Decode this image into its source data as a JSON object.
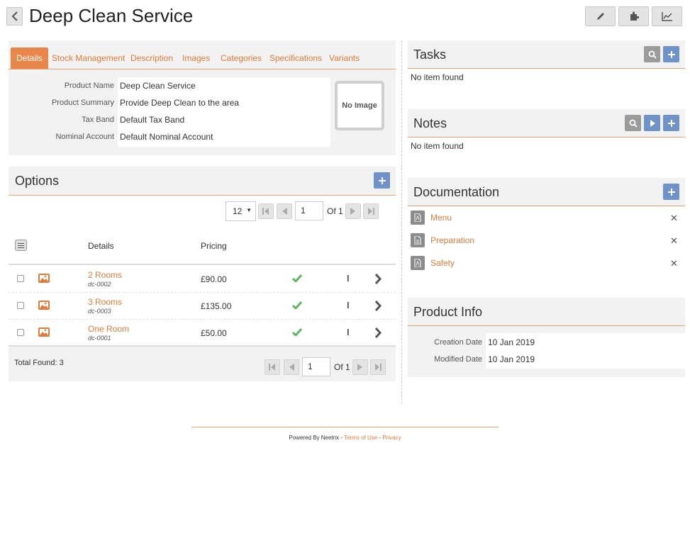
{
  "header": {
    "title": "Deep Clean Service"
  },
  "details": {
    "tabs": [
      "Details",
      "Stock Management",
      "Description",
      "Images",
      "Categories",
      "Specifications",
      "Variants"
    ],
    "fields": [
      {
        "label": "Product Name",
        "value": "Deep Clean Service"
      },
      {
        "label": "Product Summary",
        "value": "Provide Deep Clean to the area"
      },
      {
        "label": "Tax Band",
        "value": "Default Tax Band"
      },
      {
        "label": "Nominal Account",
        "value": "Default Nominal Account"
      }
    ],
    "no_image": "No Image"
  },
  "options": {
    "title": "Options",
    "page_size": "12",
    "page": "1",
    "of": "Of 1",
    "columns": {
      "details": "Details",
      "pricing": "Pricing"
    },
    "rows": [
      {
        "name": "2 Rooms",
        "code": "dc-0002",
        "price": "£90.00"
      },
      {
        "name": "3 Rooms",
        "code": "dc-0003",
        "price": "£135.00"
      },
      {
        "name": "One Room",
        "code": "dc-0001",
        "price": "£50.00"
      }
    ],
    "total": "Total Found: 3"
  },
  "tasks": {
    "title": "Tasks",
    "empty": "No item found"
  },
  "notes": {
    "title": "Notes",
    "empty": "No item found"
  },
  "documentation": {
    "title": "Documentation",
    "items": [
      {
        "name": "Menu",
        "icon": "pdf-icon"
      },
      {
        "name": "Preparation",
        "icon": "document-icon"
      },
      {
        "name": "Safety",
        "icon": "pdf-icon"
      }
    ]
  },
  "product_info": {
    "title": "Product Info",
    "fields": [
      {
        "label": "Creation Date",
        "value": "10 Jan 2019"
      },
      {
        "label": "Modified Date",
        "value": "10 Jan 2019"
      }
    ]
  },
  "footer": {
    "powered": "Powered By Neetrix",
    "sep1": " - ",
    "terms": "Terms of Use",
    "sep2": " - ",
    "privacy": "Privacy"
  },
  "colors": {
    "accent": "#e07b39",
    "blue": "#6f92c9",
    "green": "#5cb85c"
  }
}
